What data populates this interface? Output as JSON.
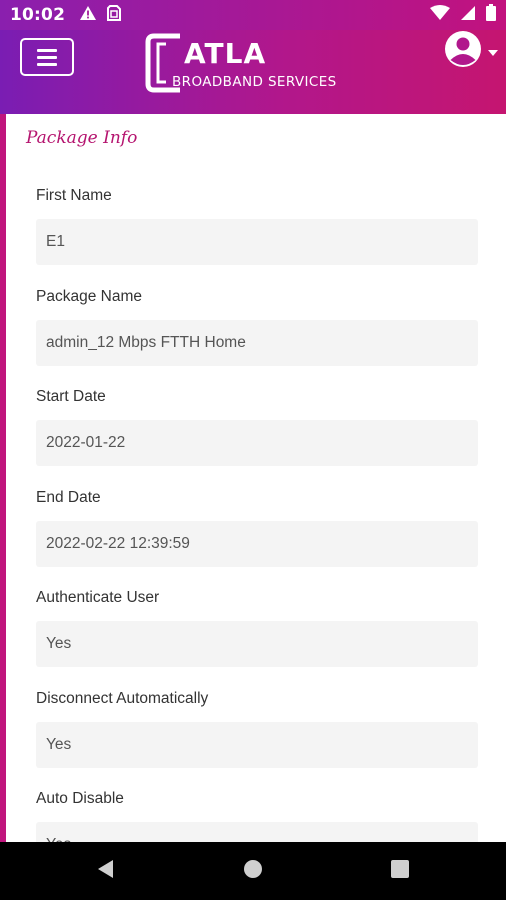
{
  "status_bar": {
    "time": "10:02"
  },
  "header": {
    "logo_word": "ATLA",
    "logo_subtitle": "BROADBAND SERVICES"
  },
  "section_title": "Package Info",
  "fields": [
    {
      "label": "First Name",
      "value": "E1"
    },
    {
      "label": "Package Name",
      "value": "admin_12 Mbps FTTH Home"
    },
    {
      "label": "Start Date",
      "value": "2022-01-22"
    },
    {
      "label": "End Date",
      "value": "2022-02-22 12:39:59"
    },
    {
      "label": "Authenticate User",
      "value": "Yes"
    },
    {
      "label": "Disconnect Automatically",
      "value": "Yes"
    },
    {
      "label": "Auto Disable",
      "value": "Yes"
    }
  ],
  "colors": {
    "brand_purple": "#7a1db3",
    "brand_magenta": "#c0157d",
    "field_background": "#f4f4f4"
  },
  "icons": {
    "status": [
      "warning-icon",
      "sim-icon",
      "wifi-icon",
      "cellular-icon",
      "battery-icon"
    ],
    "header": [
      "menu-icon",
      "account-circle-icon",
      "dropdown-caret-icon"
    ],
    "navigation": [
      "back-icon",
      "home-icon",
      "recents-icon"
    ]
  }
}
